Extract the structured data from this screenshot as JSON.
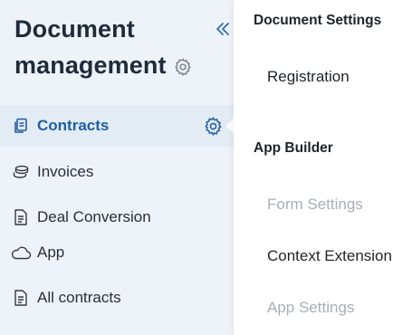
{
  "header": {
    "title_line1": "Document",
    "title_line2": "management"
  },
  "sidebar": {
    "items": [
      {
        "label": "Contracts",
        "icon": "copy-documents-icon",
        "active": true
      },
      {
        "label": "Invoices",
        "icon": "coins-icon",
        "active": false
      },
      {
        "label": "Deal Conversion",
        "icon": "document-icon",
        "active": false
      },
      {
        "label": "App",
        "icon": "cloud-icon",
        "active": false
      },
      {
        "label": "All contracts",
        "icon": "document-icon",
        "active": false
      }
    ]
  },
  "dropdown": {
    "sections": [
      {
        "header": "Document Settings",
        "items": [
          {
            "label": "Registration",
            "enabled": true
          }
        ]
      },
      {
        "header": "App Builder",
        "items": [
          {
            "label": "Form Settings",
            "enabled": false
          },
          {
            "label": "Context Extension",
            "enabled": true
          },
          {
            "label": "App Settings",
            "enabled": false
          }
        ]
      }
    ]
  },
  "colors": {
    "sidebar_bg": "#eef3f9",
    "active_bg": "#e3ebf5",
    "accent": "#1e5fa0",
    "disabled_text": "#a9aeb4"
  }
}
